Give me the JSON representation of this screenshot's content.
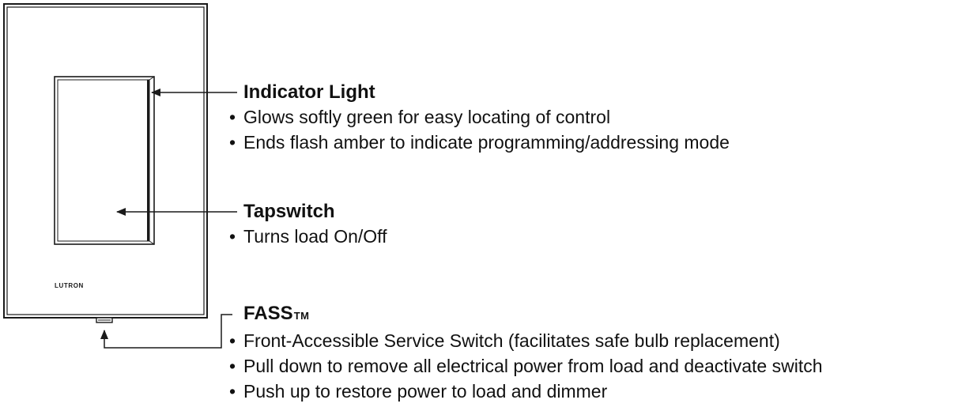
{
  "device": {
    "brand_text": "LUTRON"
  },
  "callouts": {
    "indicator": {
      "title": "Indicator Light",
      "bullets": [
        "Glows softly green for easy locating of control",
        "Ends flash amber to indicate programming/addressing mode"
      ]
    },
    "tapswitch": {
      "title": "Tapswitch",
      "bullets": [
        "Turns load On/Off"
      ]
    },
    "fass": {
      "title": "FASS",
      "title_suffix": "TM",
      "bullets": [
        "Front-Accessible Service Switch (facilitates safe bulb replacement)",
        "Pull down to remove all electrical power from load and deactivate switch",
        "Push up to restore power to load and dimmer"
      ]
    }
  },
  "colors": {
    "line": "#1a1a1a",
    "text": "#111111",
    "background": "#ffffff"
  }
}
